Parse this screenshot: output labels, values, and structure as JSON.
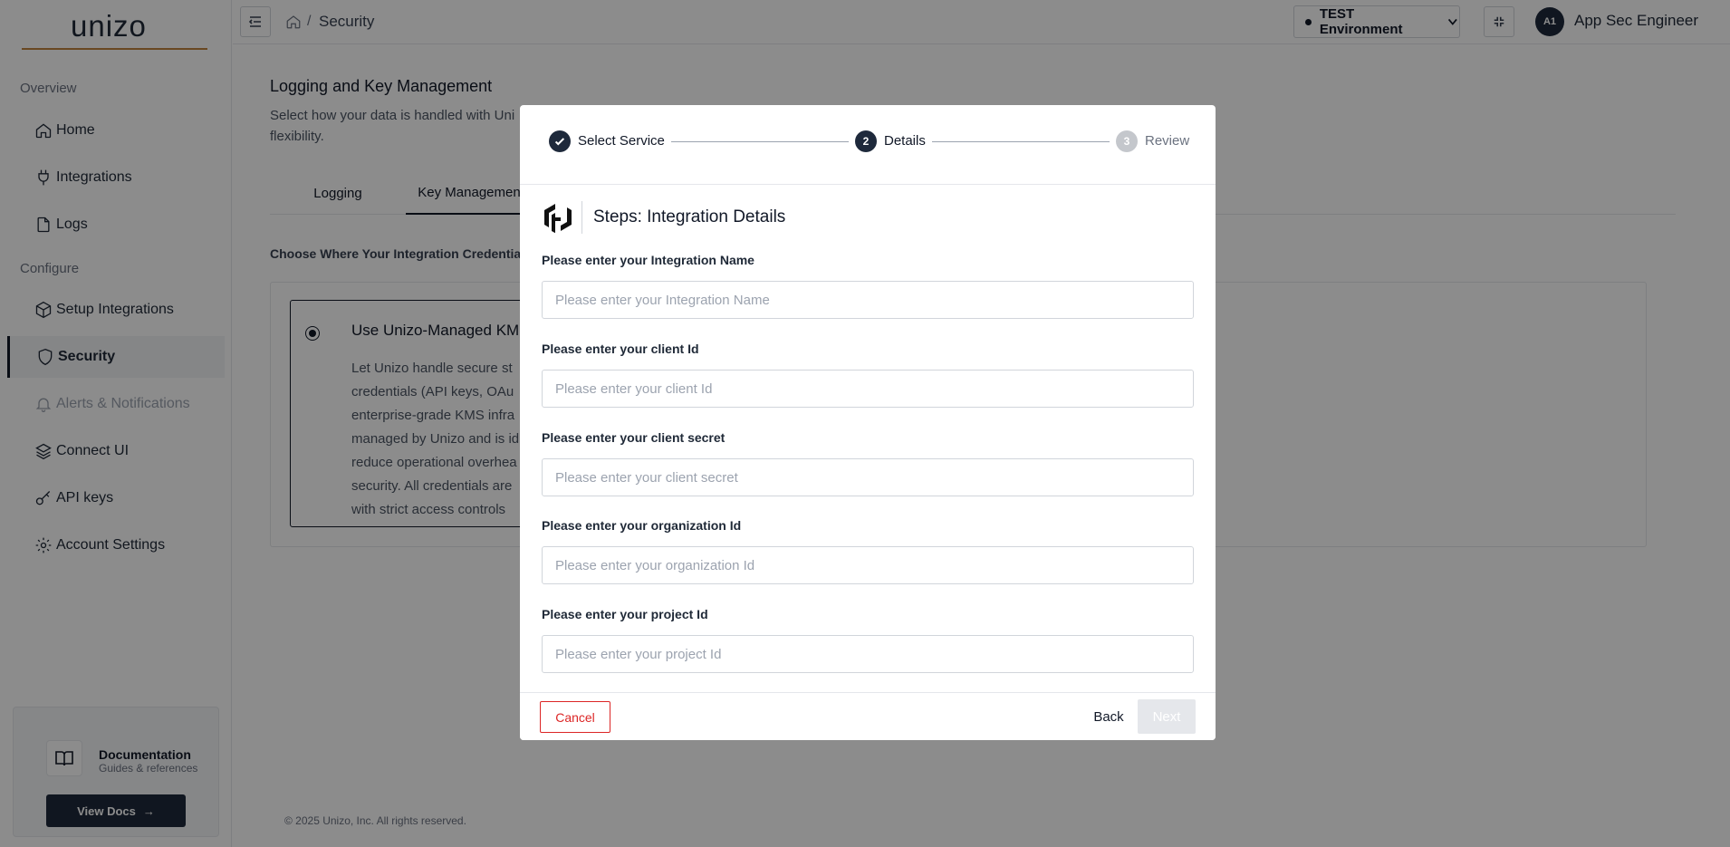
{
  "app": {
    "logo": "unizo"
  },
  "sidebar": {
    "sections": {
      "overview": "Overview",
      "configure": "Configure"
    },
    "items": [
      {
        "label": "Home",
        "icon": "home-icon"
      },
      {
        "label": "Integrations",
        "icon": "plug-icon"
      },
      {
        "label": "Logs",
        "icon": "file-icon"
      },
      {
        "label": "Setup Integrations",
        "icon": "box-icon"
      },
      {
        "label": "Security",
        "icon": "shield-icon",
        "active": true
      },
      {
        "label": "Alerts & Notifications",
        "icon": "bell-icon",
        "disabled": true
      },
      {
        "label": "Connect UI",
        "icon": "layers-icon"
      },
      {
        "label": "API keys",
        "icon": "key-icon"
      },
      {
        "label": "Account Settings",
        "icon": "gear-icon"
      }
    ],
    "docs": {
      "title": "Documentation",
      "subtitle": "Guides & references",
      "button": "View Docs",
      "button_arrow": "→"
    }
  },
  "header": {
    "breadcrumb_sep": "/",
    "breadcrumb_current": "Security",
    "environment": "TEST Environment",
    "avatar_initials": "A1",
    "user_name": "App Sec Engineer"
  },
  "main": {
    "title": "Logging and Key Management",
    "description_line1": "Select how your data is handled with Uni",
    "description_line2": "flexibility.",
    "tabs": [
      "Logging",
      "Key Managemen"
    ],
    "choose_label": "Choose Where Your Integration Credentia",
    "option": {
      "title": "Use Unizo-Managed KM",
      "desc_lines": [
        "Let Unizo handle secure st",
        "credentials (API keys, OAu",
        "enterprise-grade KMS infra",
        "managed by Unizo and is id",
        "reduce operational overhea",
        "security. All credentials are",
        "with strict access controls"
      ]
    },
    "copyright": "© 2025 Unizo, Inc. All rights reserved."
  },
  "modal": {
    "steps": [
      {
        "label": "Select Service",
        "state": "done",
        "number": "1"
      },
      {
        "label": "Details",
        "state": "current",
        "number": "2"
      },
      {
        "label": "Review",
        "state": "pending",
        "number": "3"
      }
    ],
    "heading": "Steps: Integration Details",
    "fields": [
      {
        "label": "Please enter your Integration Name",
        "placeholder": "Please enter your Integration Name",
        "value": ""
      },
      {
        "label": "Please enter your client Id",
        "placeholder": "Please enter your client Id",
        "value": ""
      },
      {
        "label": "Please enter your client secret",
        "placeholder": "Please enter your client secret",
        "value": ""
      },
      {
        "label": "Please enter your organization Id",
        "placeholder": "Please enter your organization Id",
        "value": ""
      },
      {
        "label": "Please enter your project Id",
        "placeholder": "Please enter your project Id",
        "value": ""
      }
    ],
    "buttons": {
      "cancel": "Cancel",
      "back": "Back",
      "next": "Next"
    }
  },
  "colors": {
    "accent": "#1e293b",
    "danger": "#dc2626",
    "logo_underline": "#c0843f"
  }
}
